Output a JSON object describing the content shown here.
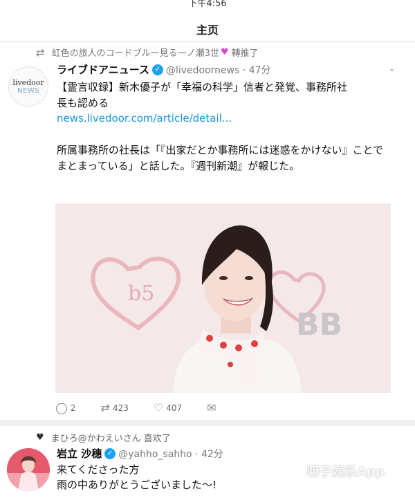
{
  "status_bar": {
    "time": "下午4:56"
  },
  "nav": {
    "title": "主页"
  },
  "tweet1": {
    "retweet_by": "虹色の旅人のコードブルー見る一ノ瀬3世",
    "retweet_label": "轉推了",
    "avatar_text_top": "livedoor",
    "avatar_text_bottom": "NEWS",
    "author_name": "ライブドアニュース",
    "handle_time": "@livedoornews · 47分",
    "text_line1": "【霊言収録】新木優子が「幸福の科学」信者と発覚、事務所社長も認める",
    "link": "news.livedoor.com/article/detail...",
    "text_line2": "所属事務所の社長は「『出家だとか事務所には迷惑をかけない』ことでまとまっている」と話した。『週刊新潮』が報じた。",
    "photo_text_bb": "BB",
    "photo_text_left": "b5",
    "actions": {
      "reply": "2",
      "retweet": "423",
      "like": "407"
    }
  },
  "tweet2": {
    "liked_by": "まひろ@かわえいさん 喜欢了",
    "author_name": "岩立 沙穗",
    "handle_time": "@yahho_sahho · 42分",
    "line1": "来てくださった方",
    "line2": "雨の中ありがとうございました〜!"
  },
  "watermark": "嘛子娱乐App",
  "colors": {
    "link": "#1b95e0",
    "verified": "#1da1f2",
    "heart_pink": "#d64ad0"
  }
}
